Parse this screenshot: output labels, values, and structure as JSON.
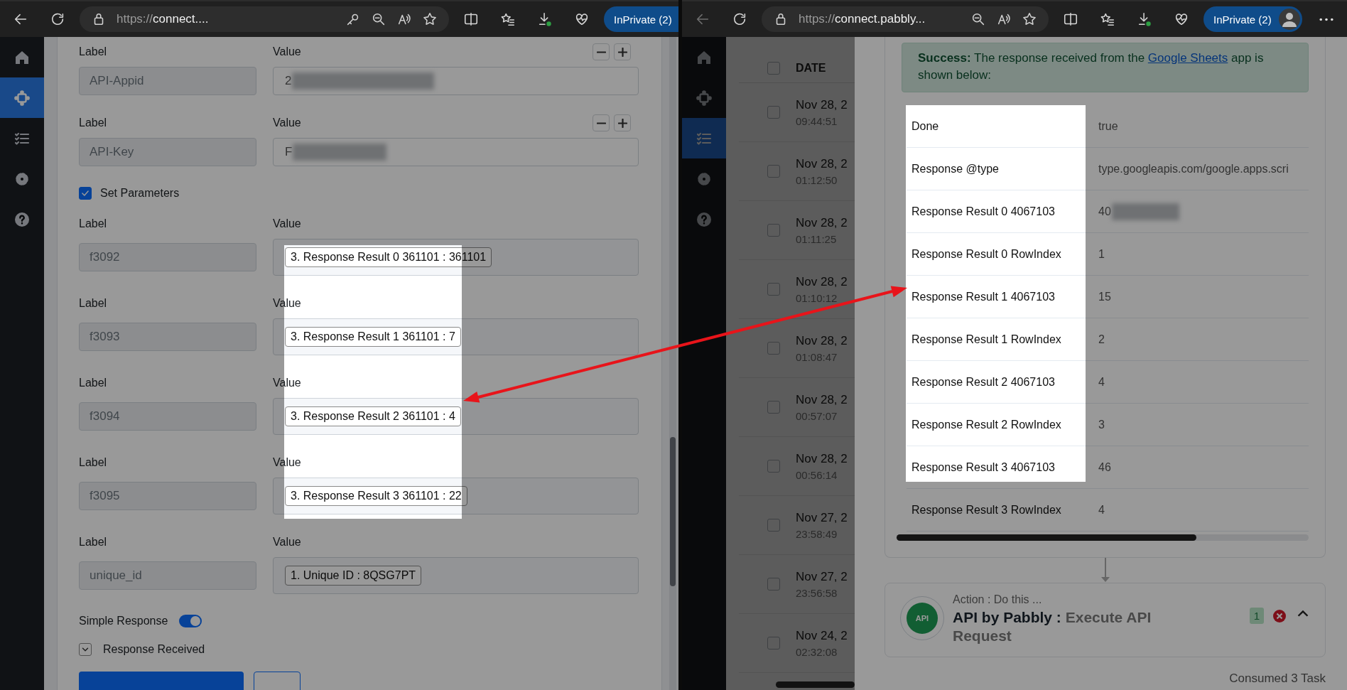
{
  "left_window": {
    "toolbar": {
      "back_enabled": true,
      "url_scheme": "https://",
      "url_host": "connect....",
      "address_icons": [
        {
          "kind": "key"
        },
        {
          "kind": "zoom-out"
        },
        {
          "kind": "read-aloud"
        },
        {
          "kind": "favorite"
        }
      ],
      "profile": "InPrivate (2)"
    },
    "sidebar": [
      {
        "kind": "home",
        "selected": false
      },
      {
        "kind": "workflow",
        "selected": true
      },
      {
        "kind": "tasks",
        "selected": false
      },
      {
        "kind": "settings",
        "selected": false
      },
      {
        "kind": "help",
        "selected": false
      }
    ],
    "form": {
      "rows": [
        {
          "label_caption": "Label",
          "value_caption": "Value",
          "label": "API-Appid",
          "value": "2",
          "redacted": true,
          "stepper": true
        },
        {
          "label_caption": "Label",
          "value_caption": "Value",
          "label": "API-Key",
          "value": "F",
          "redacted": true,
          "stepper": true
        },
        {
          "kind": "checkbox",
          "label": "Set Parameters",
          "checked": true
        },
        {
          "label_caption": "Label",
          "value_caption": "Value",
          "label": "f3092",
          "tag": "3. Response Result 0 361101 : 361101"
        },
        {
          "label_caption": "Label",
          "value_caption": "Value",
          "label": "f3093",
          "tag": "3. Response Result 1 361101 : 7"
        },
        {
          "label_caption": "Label",
          "value_caption": "Value",
          "label": "f3094",
          "tag": "3. Response Result 2 361101 : 4"
        },
        {
          "label_caption": "Label",
          "value_caption": "Value",
          "label": "f3095",
          "tag": "3. Response Result 3 361101 : 22"
        },
        {
          "label_caption": "Label",
          "value_caption": "Value",
          "label": "unique_id",
          "tag": "1. Unique ID : 8QSG7PT"
        }
      ],
      "simple_response": {
        "label": "Simple Response",
        "on": true
      },
      "response_received": {
        "label": "Response Received"
      }
    }
  },
  "right_window": {
    "toolbar": {
      "back_enabled": false,
      "url_scheme": "https://",
      "url_host": "connect.pabbly...",
      "address_icons": [
        {
          "kind": "zoom-out"
        },
        {
          "kind": "read-aloud"
        },
        {
          "kind": "favorite"
        }
      ],
      "profile": "InPrivate (2)"
    },
    "sidebar": [
      {
        "kind": "home",
        "selected": false
      },
      {
        "kind": "workflow",
        "selected": false
      },
      {
        "kind": "tasks",
        "selected": true
      },
      {
        "kind": "settings",
        "selected": false
      },
      {
        "kind": "help",
        "selected": false
      }
    ],
    "history": {
      "header": "DATE",
      "header_checked": false,
      "rows": [
        {
          "date": "Nov 28, 2",
          "time": "09:44:51",
          "checked": false
        },
        {
          "date": "Nov 28, 2",
          "time": "01:12:50",
          "checked": false
        },
        {
          "date": "Nov 28, 2",
          "time": "01:11:25",
          "checked": false
        },
        {
          "date": "Nov 28, 2",
          "time": "01:10:12",
          "checked": false
        },
        {
          "date": "Nov 28, 2",
          "time": "01:08:47",
          "checked": false
        },
        {
          "date": "Nov 28, 2",
          "time": "00:57:07",
          "checked": false
        },
        {
          "date": "Nov 28, 2",
          "time": "00:56:14",
          "checked": false
        },
        {
          "date": "Nov 27, 2",
          "time": "23:58:49",
          "checked": false
        },
        {
          "date": "Nov 27, 2",
          "time": "23:56:58",
          "checked": false
        },
        {
          "date": "Nov 24, 2",
          "time": "02:32:08",
          "checked": false
        }
      ]
    },
    "response": {
      "alert": {
        "lead": "Success:",
        "before": " The response received from the ",
        "link": "Google Sheets",
        "after": " app is shown below:"
      },
      "rows": [
        {
          "name": "Done",
          "value": "true"
        },
        {
          "name": "Response @type",
          "value": "type.googleapis.com/google.apps.scri"
        },
        {
          "name": "Response Result 0 4067103",
          "value": "40",
          "redacted": true
        },
        {
          "name": "Response Result 0 RowIndex",
          "value": "1"
        },
        {
          "name": "Response Result 1 4067103",
          "value": "15"
        },
        {
          "name": "Response Result 1 RowIndex",
          "value": "2"
        },
        {
          "name": "Response Result 2 4067103",
          "value": "4"
        },
        {
          "name": "Response Result 2 RowIndex",
          "value": "3"
        },
        {
          "name": "Response Result 3 4067103",
          "value": "46"
        },
        {
          "name": "Response Result 3 RowIndex",
          "value": "4"
        }
      ],
      "action": {
        "icon_text": "API",
        "subtitle": "Action : Do this ...",
        "app": "API by Pabbly :",
        "title": "Execute API Request",
        "count": "1"
      },
      "footer": "Consumed 3 Task"
    }
  }
}
